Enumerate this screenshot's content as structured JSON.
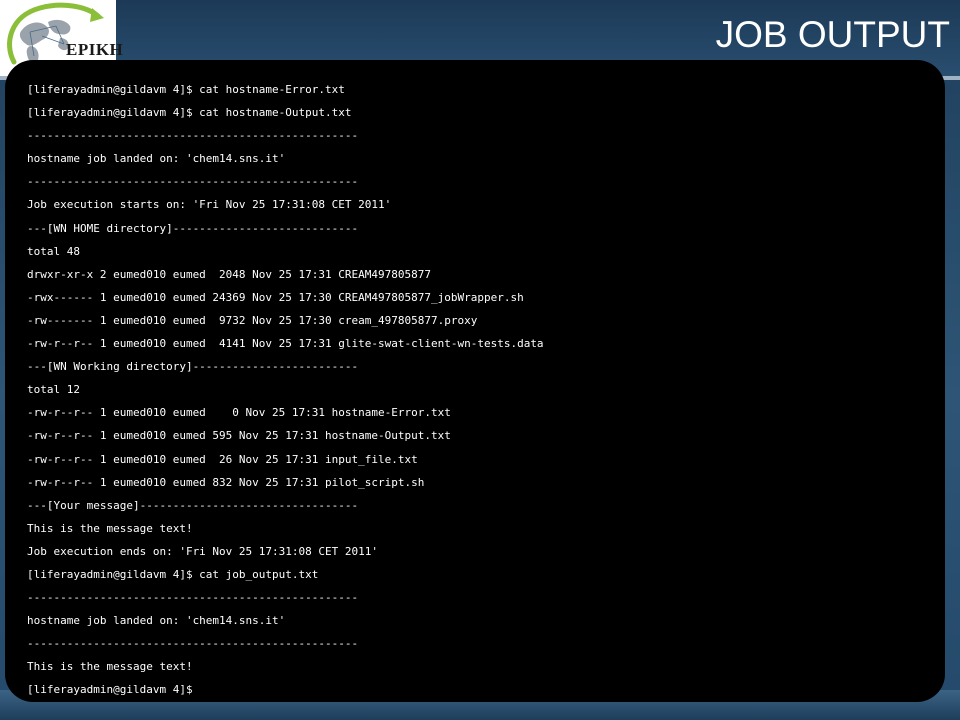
{
  "header": {
    "title": "JOB OUTPUT",
    "logo_text": "EPIKH"
  },
  "terminal": {
    "lines": [
      "[liferayadmin@gildavm 4]$ cat hostname-Error.txt",
      "[liferayadmin@gildavm 4]$ cat hostname-Output.txt",
      "--------------------------------------------------",
      "hostname job landed on: 'chem14.sns.it'",
      "--------------------------------------------------",
      "Job execution starts on: 'Fri Nov 25 17:31:08 CET 2011'",
      "---[WN HOME directory]----------------------------",
      "total 48",
      "drwxr-xr-x 2 eumed010 eumed  2048 Nov 25 17:31 CREAM497805877",
      "-rwx------ 1 eumed010 eumed 24369 Nov 25 17:30 CREAM497805877_jobWrapper.sh",
      "-rw------- 1 eumed010 eumed  9732 Nov 25 17:30 cream_497805877.proxy",
      "-rw-r--r-- 1 eumed010 eumed  4141 Nov 25 17:31 glite-swat-client-wn-tests.data",
      "---[WN Working directory]-------------------------",
      "total 12",
      "-rw-r--r-- 1 eumed010 eumed    0 Nov 25 17:31 hostname-Error.txt",
      "-rw-r--r-- 1 eumed010 eumed 595 Nov 25 17:31 hostname-Output.txt",
      "-rw-r--r-- 1 eumed010 eumed  26 Nov 25 17:31 input_file.txt",
      "-rw-r--r-- 1 eumed010 eumed 832 Nov 25 17:31 pilot_script.sh",
      "---[Your message]---------------------------------",
      "This is the message text!",
      "Job execution ends on: 'Fri Nov 25 17:31:08 CET 2011'",
      "[liferayadmin@gildavm 4]$ cat job_output.txt",
      "--------------------------------------------------",
      "hostname job landed on: 'chem14.sns.it'",
      "--------------------------------------------------",
      "This is the message text!",
      "[liferayadmin@gildavm 4]$"
    ]
  },
  "colors": {
    "header_bg": "#1c3a57",
    "terminal_bg": "#000000",
    "terminal_text": "#ffffff",
    "title_text": "#ffffff",
    "logo_swoosh": "#8bbf3a"
  },
  "icons": {
    "logo": "world-map-logo-icon"
  }
}
